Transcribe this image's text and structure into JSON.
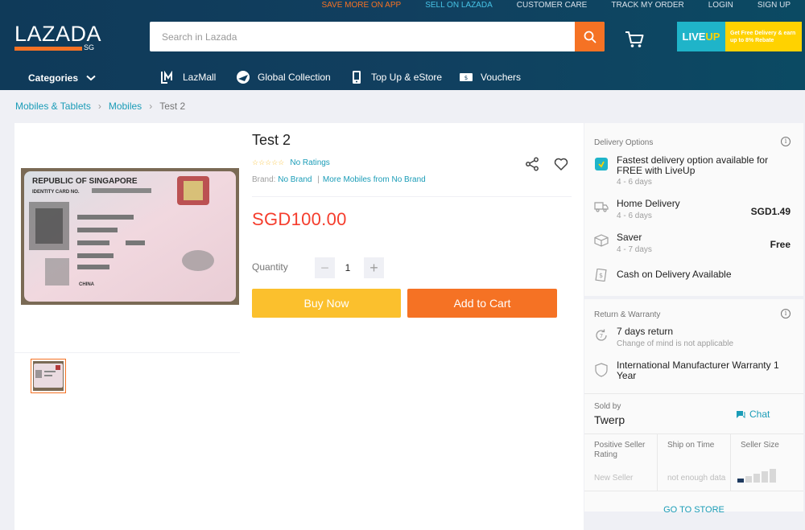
{
  "header": {
    "top_links": [
      "SAVE MORE ON APP",
      "SELL ON LAZADA",
      "CUSTOMER CARE",
      "TRACK MY ORDER",
      "LOGIN",
      "SIGN UP"
    ],
    "logo_text": "LAZADA",
    "logo_suffix": "SG",
    "search_placeholder": "Search in Lazada",
    "liveup_brand_a": "LIVE",
    "liveup_brand_b": "UP",
    "liveup_promo": "Get Free Delivery & earn up to 8% Rebate",
    "categories_label": "Categories",
    "nav_items": [
      "LazMall",
      "Global Collection",
      "Top Up & eStore",
      "Vouchers"
    ]
  },
  "breadcrumb": [
    "Mobiles & Tablets",
    "Mobiles",
    "Test 2"
  ],
  "product": {
    "title": "Test 2",
    "stars": "☆☆☆☆☆",
    "ratings_text": "No Ratings",
    "brand_label": "Brand:",
    "brand_value": "No Brand",
    "more_from": "More Mobiles from No Brand",
    "price": "SGD100.00",
    "quantity_label": "Quantity",
    "quantity_value": "1",
    "minus": "−",
    "plus": "+",
    "buy_now": "Buy Now",
    "add_to_cart": "Add to Cart",
    "id_card_lines": [
      "REPUBLIC OF SINGAPORE",
      "IDENTITY CARD NO.",
      "CHINA"
    ]
  },
  "delivery": {
    "title": "Delivery Options",
    "options": [
      {
        "title": "Fastest delivery option available for FREE with LiveUp",
        "sub": "4 - 6 days",
        "price": ""
      },
      {
        "title": "Home Delivery",
        "sub": "4 - 6 days",
        "price": "SGD1.49"
      },
      {
        "title": "Saver",
        "sub": "4 - 7 days",
        "price": "Free"
      },
      {
        "title": "Cash on Delivery Available",
        "sub": "",
        "price": ""
      }
    ]
  },
  "warranty": {
    "title": "Return & Warranty",
    "return_title": "7 days return",
    "return_sub": "Change of mind is not applicable",
    "warranty_text": "International Manufacturer Warranty 1 Year"
  },
  "seller": {
    "sold_by": "Sold by",
    "name": "Twerp",
    "chat": "Chat",
    "metrics": [
      {
        "label": "Positive Seller Rating",
        "value": "New Seller"
      },
      {
        "label": "Ship on Time",
        "value": "not enough data"
      },
      {
        "label": "Seller Size",
        "value": ""
      }
    ],
    "seller_size_level": 1,
    "go_to_store": "GO TO STORE"
  }
}
